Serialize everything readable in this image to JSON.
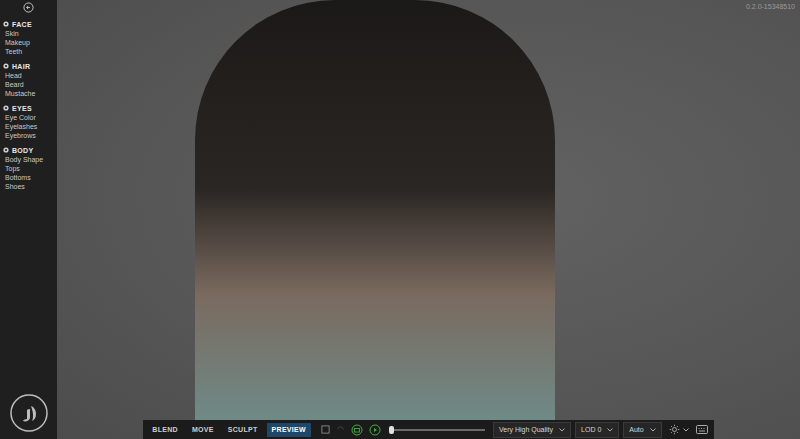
{
  "sidebar": {
    "sections": [
      {
        "label": "FACE",
        "items": [
          "Skin",
          "Makeup",
          "Teeth"
        ]
      },
      {
        "label": "HAIR",
        "items": [
          "Head",
          "Beard",
          "Mustache"
        ]
      },
      {
        "label": "EYES",
        "items": [
          "Eye Color",
          "Eyelashes",
          "Eyebrows"
        ]
      },
      {
        "label": "BODY",
        "items": [
          "Body Shape",
          "Tops",
          "Bottoms",
          "Shoes"
        ]
      }
    ]
  },
  "version": "0.2.0-15348510",
  "toolbar": {
    "modes": [
      {
        "label": "BLEND",
        "selected": false
      },
      {
        "label": "MOVE",
        "selected": false
      },
      {
        "label": "SCULPT",
        "selected": false
      },
      {
        "label": "PREVIEW",
        "selected": true
      }
    ],
    "timeline": {
      "level": 0.02
    },
    "dropdowns": [
      {
        "value": "Very High Quality"
      },
      {
        "value": "LOD 0"
      },
      {
        "value": "Auto"
      }
    ]
  }
}
